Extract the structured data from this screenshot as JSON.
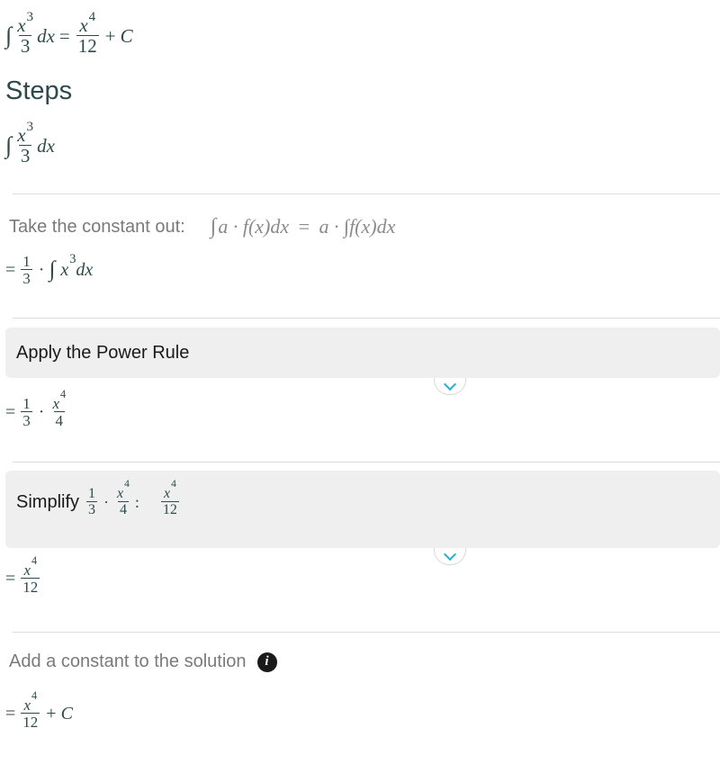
{
  "result": {
    "integrand_num": "x",
    "integrand_num_exp": "3",
    "integrand_den": "3",
    "differential": "dx",
    "equals": "=",
    "answer_num": "x",
    "answer_num_exp": "4",
    "answer_den": "12",
    "plus": "+",
    "constant": "C"
  },
  "steps_heading": "Steps",
  "step_start": {
    "num": "x",
    "exp": "3",
    "den": "3",
    "differential": "dx"
  },
  "constant_rule": {
    "label": "Take the constant out:",
    "formula_lhs": "a · f(x)dx",
    "formula_eq": "=",
    "formula_rhs": "a · ∫f(x)dx"
  },
  "line_after_constant": {
    "eq": "=",
    "num": "1",
    "den": "3",
    "dot": "·",
    "x": "x",
    "exp": "3",
    "dx": "dx"
  },
  "power_rule": {
    "title": "Apply the Power Rule"
  },
  "line_after_power": {
    "eq": "=",
    "c_num": "1",
    "c_den": "3",
    "dot": "·",
    "num": "x",
    "exp": "4",
    "den": "4"
  },
  "simplify": {
    "title": "Simplify",
    "a_num": "1",
    "a_den": "3",
    "dot": "·",
    "b_num": "x",
    "b_exp": "4",
    "b_den": "4",
    "colon": ":",
    "r_num": "x",
    "r_exp": "4",
    "r_den": "12"
  },
  "line_after_simplify": {
    "eq": "=",
    "num": "x",
    "exp": "4",
    "den": "12"
  },
  "add_constant": {
    "label": "Add a constant to the solution",
    "info_glyph": "i"
  },
  "final": {
    "eq": "=",
    "num": "x",
    "exp": "4",
    "den": "12",
    "plus": "+",
    "constant": "C"
  }
}
